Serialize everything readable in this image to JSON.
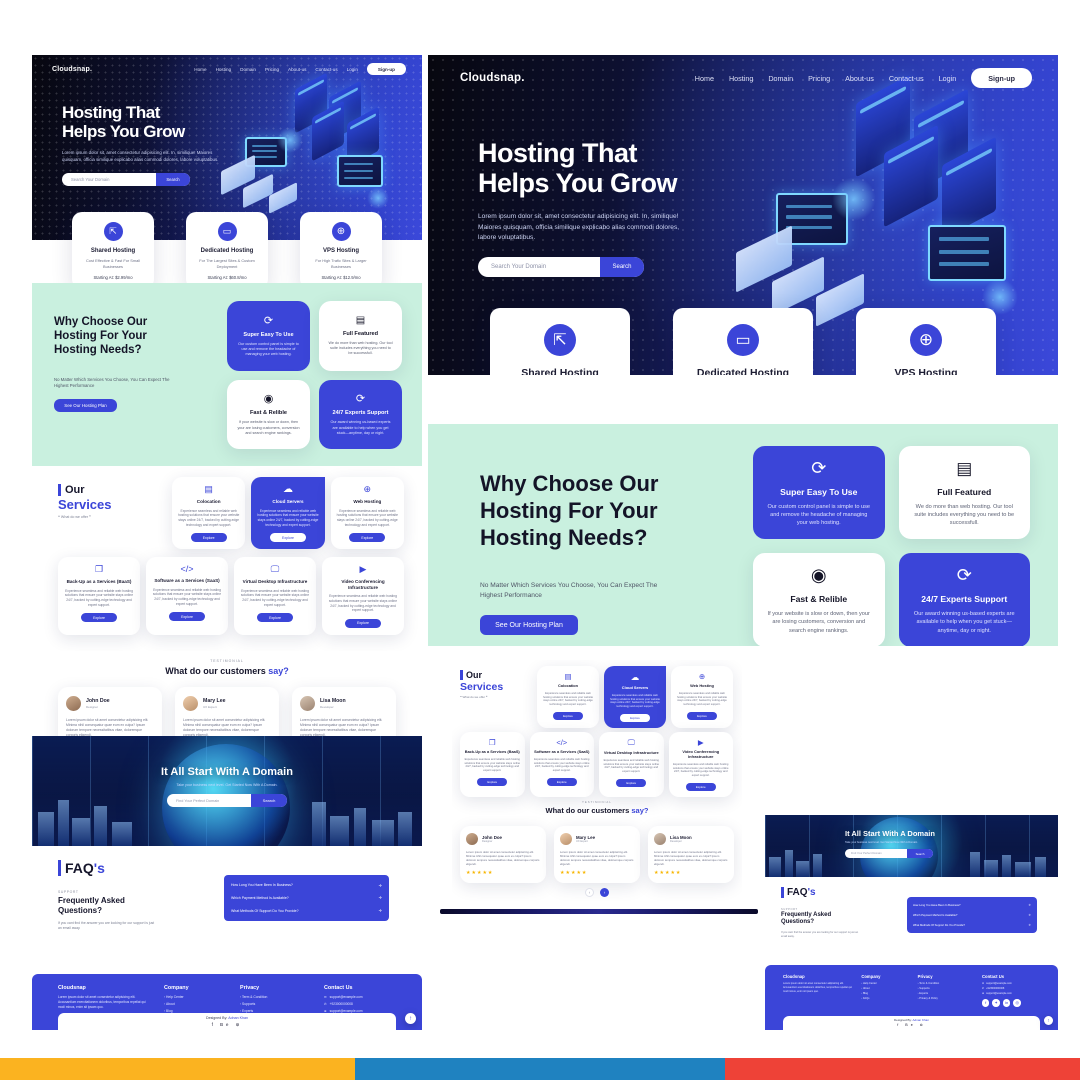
{
  "brand": {
    "name": "Cloudsnap",
    "dot": "."
  },
  "nav": {
    "links": [
      "Home",
      "Hosting",
      "Domain",
      "Pricing",
      "About-us",
      "Contact-us",
      "Login"
    ],
    "signup": "Sign-up"
  },
  "hero": {
    "title_line1": "Hosting That",
    "title_line2": "Helps You Grow",
    "paragraph": "Lorem ipsum dolor sit, amet consectetur adipisicing elit. In, similique! Maiores quisquam, officia similique explicabo alias commodi dolores, labore voluptatibus.",
    "search_placeholder": "Search Your Domain",
    "search_button": "Search"
  },
  "plans": [
    {
      "icon": "share-box-icon",
      "title": "Shared Hosting",
      "desc": "Cost Effective & Fast For Small Businesses",
      "price": "Starting At: $2.99/mo"
    },
    {
      "icon": "monitor-icon",
      "title": "Dedicated Hosting",
      "desc": "For The Largest Sites & Custom Deployment",
      "price": "Starting At: $60.8/mo"
    },
    {
      "icon": "globe-icon",
      "title": "VPS Hosting",
      "desc": "For High Trafic Sites & Larger Businesses",
      "price": "Starting At: $12.9/mo"
    }
  ],
  "why": {
    "heading_l1": "Why Choose Our",
    "heading_l2": "Hosting For Your",
    "heading_l3": "Hosting Needs?",
    "paragraph": "No Matter Which Services You Choose, You Can Expect The Highest Performance",
    "button": "See Our Hosting Plan",
    "cards": [
      {
        "icon": "refresh-icon",
        "title": "Super Easy To Use",
        "desc": "Our custom control panel is simple to use and remove the headache of managing your web hosting.",
        "style": "blue"
      },
      {
        "icon": "server-icon",
        "title": "Full Featured",
        "desc": "We do more than web hosting. Our tool suite includes everything you need to be successfull.",
        "style": "white"
      },
      {
        "icon": "speedometer-icon",
        "title": "Fast & Relible",
        "desc": "If your website is slow or down, then your are losing customers, conversion and search engine rankings.",
        "style": "white"
      },
      {
        "icon": "refresh-icon",
        "title": "24/7 Experts Support",
        "desc": "Our award winning us-based experts are available to help when you get stuck—anytime, day or night.",
        "style": "blue"
      }
    ]
  },
  "services": {
    "kicker_our": "Our",
    "kicker_services": "Services",
    "kicker_sub": "❝ What do we offer ❞",
    "explore_label": "Explore",
    "common_desc": "Experience seamless and reliable web hosting solutions that ensure your website stays online 24/7, backed by cutting-edge technology and expert support.",
    "items": [
      {
        "icon": "server-stack-icon",
        "title": "Colocation",
        "active": false
      },
      {
        "icon": "cloud-icon",
        "title": "Cloud Servers",
        "active": true
      },
      {
        "icon": "globe-icon",
        "title": "Web Hosting",
        "active": false
      },
      {
        "icon": "layers-icon",
        "title": "Back-Up as a Services (BaaS)",
        "active": false
      },
      {
        "icon": "code-icon",
        "title": "Software as a Services (SaaS)",
        "active": false
      },
      {
        "icon": "desktop-icon",
        "title": "Virtual Desktop Infrastructure",
        "active": false
      },
      {
        "icon": "play-icon",
        "title": "Video Conferencing Infrastructure",
        "active": false
      }
    ]
  },
  "testimonial": {
    "kicker": "TESTIMONIAL",
    "heading_plain": "What do our customers ",
    "heading_accent": "say?",
    "stars": "★★★★★",
    "prev_icon": "chevron-left-icon",
    "next_icon": "chevron-right-icon",
    "cards": [
      {
        "name": "John Doe",
        "role": "Designer",
        "body": "Lorem ipsum dolor sit amet consectetur adipisicing elit. Minima nihil consequatur quae eum ex culpa? Ipsum dolorum tempore necessitatibus vitae, doloremque corporis eligendi."
      },
      {
        "name": "Mary Lee",
        "role": "UX Expert",
        "body": "Lorem ipsum dolor sit amet consectetur adipisicing elit. Minima nihil consequatur quae eum ex culpa? Ipsum dolorum tempore necessitatibus vitae, doloremque corporis eligendi."
      },
      {
        "name": "Lisa Moon",
        "role": "Developer",
        "body": "Lorem ipsum dolor sit amet consectetur adipisicing elit. Minima nihil consequatur quae eum ex culpa? Ipsum dolorum tempore necessitatibus vitae, doloremque corporis eligendi."
      }
    ]
  },
  "domain_banner": {
    "heading": "It All Start With A Domain",
    "subtext": "Take your business next level. Get Started Now With A Domain.",
    "placeholder": "Find Your Perfect Domain",
    "button": "Search"
  },
  "faq": {
    "title_plain": "FAQ",
    "title_accent": "'s",
    "kicker": "SUPPORT",
    "heading_l1": "Frequently Asked",
    "heading_l2": "Questions?",
    "paragraph": "If you cant find the answer you are looking for our support is just an email away.",
    "plus_icon": "plus-icon",
    "questions": [
      "How Long You Have Been In Business?",
      "Which Payment Method Is Available?",
      "What Methods Of Support Do You Provide?"
    ]
  },
  "footer": {
    "brand": "Cloudsnap",
    "about": "Lorem ipsum dolor sit amet consectetur adipisicing elit. Accusantium exercitationem doloribus, temporibus repellat qui modi minus, enim sit ipsam quo.",
    "columns": [
      {
        "heading": "Company",
        "links": [
          "Help Center",
          "About",
          "Blog",
          "FAQs"
        ]
      },
      {
        "heading": "Privacy",
        "links": [
          "Term & Condition",
          "Supports",
          "Experts",
          "Privacy & Policy"
        ]
      }
    ],
    "contact_heading": "Contact Us",
    "contacts": [
      {
        "icon": "mail-icon",
        "text": "support@example.com"
      },
      {
        "icon": "phone-icon",
        "text": "+923000000008"
      },
      {
        "icon": "globe-icon",
        "text": "support@example.com"
      }
    ],
    "socials": [
      "facebook-icon",
      "twitter-icon",
      "linkedin-icon",
      "instagram-icon"
    ],
    "credit_plain": "Designed By: ",
    "credit_name": "Adnan Khan",
    "credit_icons": "f Be ⊚",
    "to_top_icon": "arrow-up-icon"
  },
  "colors": {
    "accent": "#3b45d8",
    "mint": "#c9f0df",
    "star": "#f7b500",
    "strip_yellow": "#fbb320",
    "strip_blue": "#1f82c0",
    "strip_red": "#ee4237"
  }
}
